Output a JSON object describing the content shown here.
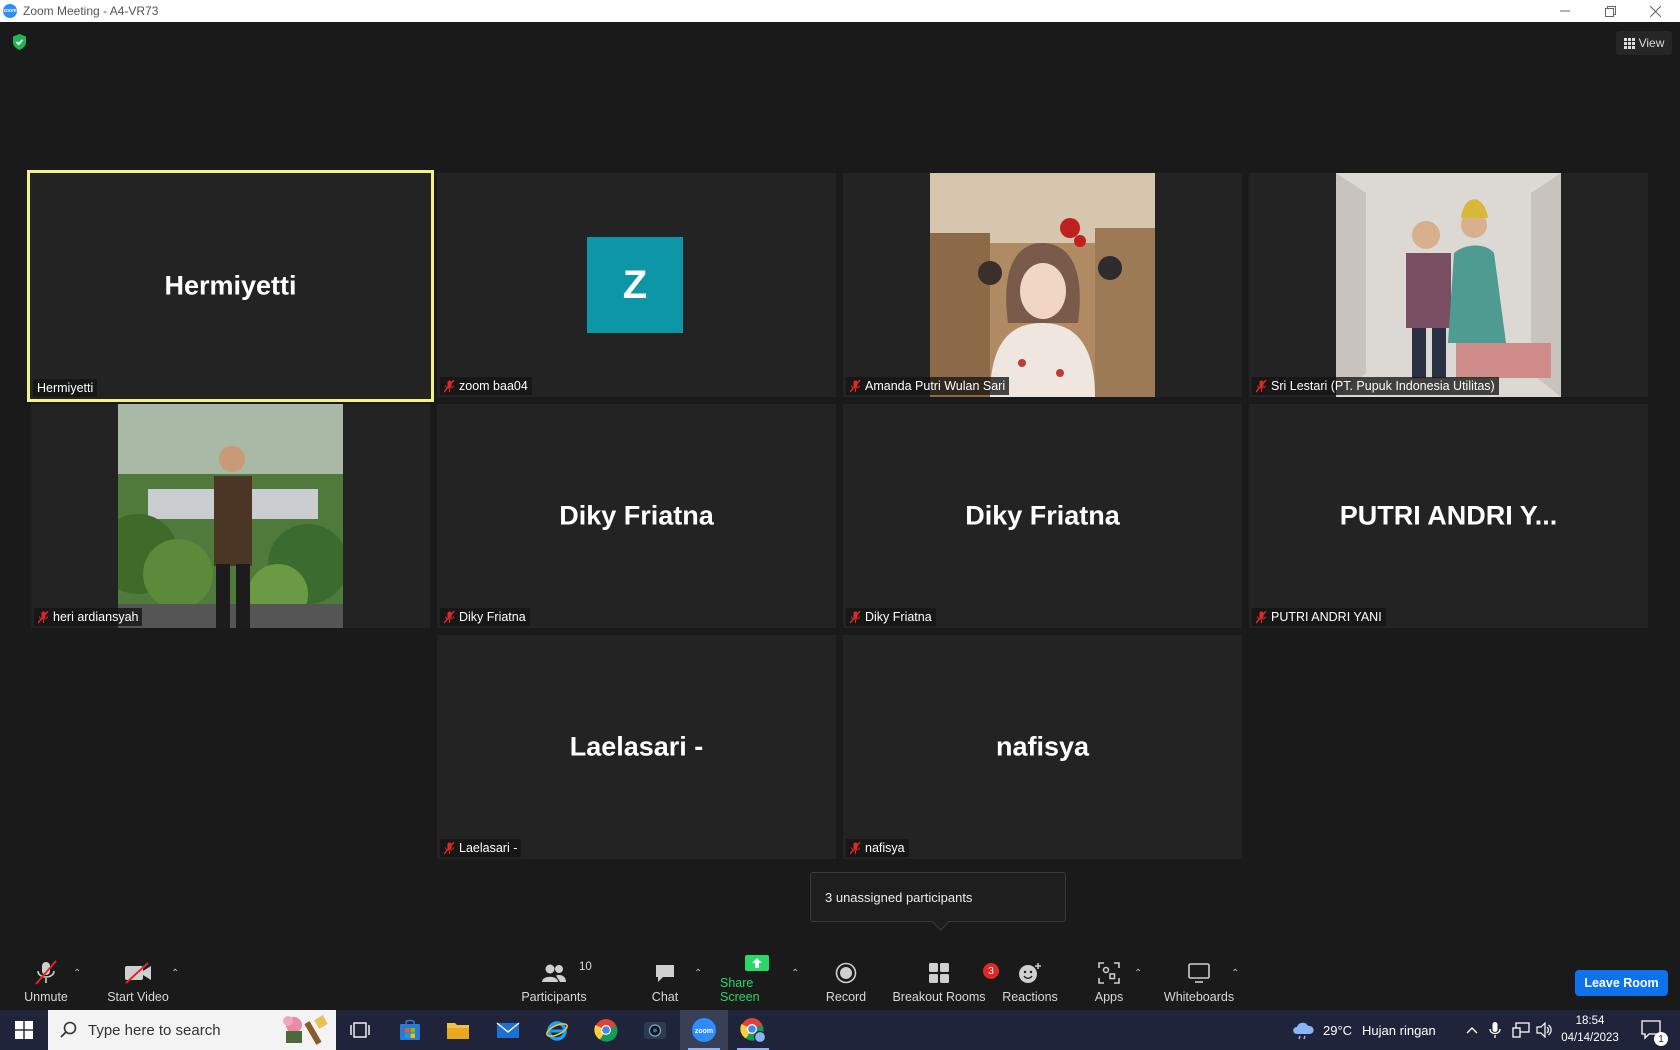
{
  "window": {
    "title": "Zoom Meeting - A4-VR73",
    "app_icon_text": "zoom",
    "controls": [
      "minimize",
      "restore",
      "close"
    ]
  },
  "view_button": {
    "label": "View"
  },
  "tiles": [
    {
      "big_name": "Hermiyetti",
      "label": "Hermiyetti",
      "muted": false,
      "active": true,
      "type": "name"
    },
    {
      "big_name": "Z",
      "label": "zoom baa04",
      "muted": true,
      "type": "avatar",
      "avatar_color": "#0d96a6"
    },
    {
      "label": "Amanda Putri Wulan Sari",
      "muted": true,
      "type": "photo"
    },
    {
      "label": "Sri Lestari (PT. Pupuk Indonesia Utilitas)",
      "muted": true,
      "type": "photo"
    },
    {
      "label": "heri ardiansyah",
      "muted": true,
      "type": "photo"
    },
    {
      "big_name": "Diky Friatna",
      "label": "Diky Friatna",
      "muted": true,
      "type": "name"
    },
    {
      "big_name": "Diky Friatna",
      "label": "Diky Friatna",
      "muted": true,
      "type": "name"
    },
    {
      "big_name": "PUTRI ANDRI Y...",
      "label": "PUTRI ANDRI YANI",
      "muted": true,
      "type": "name"
    },
    {
      "big_name": "Laelasari -",
      "label": "Laelasari -",
      "muted": true,
      "type": "name"
    },
    {
      "big_name": "nafisya",
      "label": "nafisya",
      "muted": true,
      "type": "name"
    }
  ],
  "popup": {
    "text": "3 unassigned participants"
  },
  "toolbar": {
    "unmute": "Unmute",
    "start_video": "Start Video",
    "participants": "Participants",
    "participants_count": "10",
    "chat": "Chat",
    "share_screen": "Share Screen",
    "record": "Record",
    "breakout_rooms": "Breakout Rooms",
    "breakout_badge": "3",
    "reactions": "Reactions",
    "apps": "Apps",
    "whiteboards": "Whiteboards",
    "leave": "Leave Room"
  },
  "taskbar": {
    "search_placeholder": "Type here to search",
    "weather_temp": "29°C",
    "weather_text": "Hujan ringan",
    "time": "18:54",
    "date": "04/14/2023",
    "notification_count": "1"
  },
  "colors": {
    "accent": "#0e72ed",
    "active_speaker": "#f0f28a",
    "muted_red": "#e02828",
    "share_green": "#27d86b"
  }
}
